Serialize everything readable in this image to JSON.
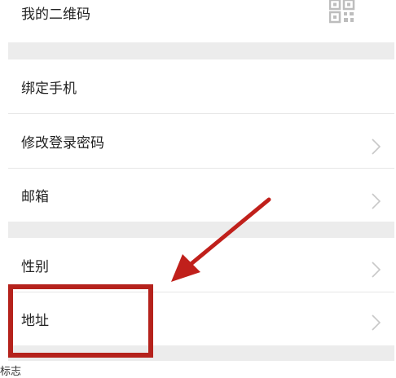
{
  "settings": {
    "items": [
      {
        "label": "我的二维码",
        "trailing": "qr-code-icon"
      },
      {
        "label": "绑定手机",
        "trailing": ""
      },
      {
        "label": "修改登录密码",
        "trailing": "chevron-right-icon"
      },
      {
        "label": "邮箱",
        "trailing": "chevron-right-icon"
      },
      {
        "label": "性别",
        "trailing": "chevron-right-icon"
      },
      {
        "label": "地址",
        "trailing": "chevron-right-icon"
      }
    ]
  },
  "annotation": {
    "arrow_color": "#c0201b",
    "box_color": "#b5221c"
  },
  "footer": {
    "partial_text": "标志"
  },
  "colors": {
    "section_gap": "#ececec",
    "divider": "#e6e6e6",
    "chevron": "#c8c8c8",
    "qr_icon": "#bdbdbd"
  }
}
